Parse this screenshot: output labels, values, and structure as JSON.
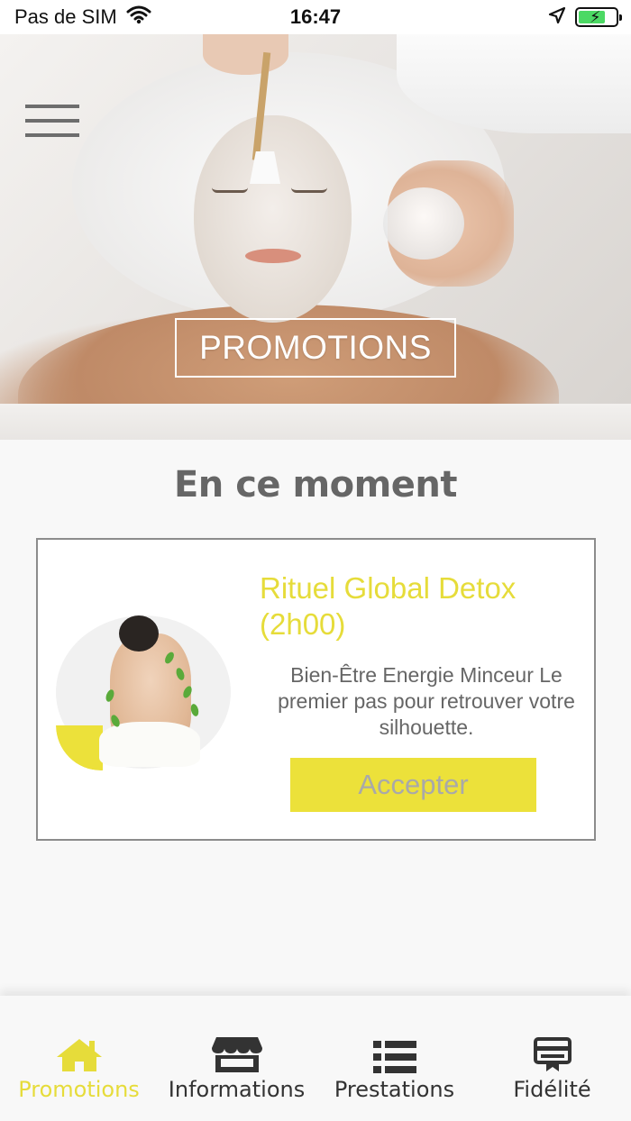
{
  "status_bar": {
    "carrier": "Pas de SIM",
    "time": "16:47",
    "battery_level": 0.72
  },
  "hero": {
    "title": "PROMOTIONS"
  },
  "section": {
    "title": "En ce moment"
  },
  "promotion": {
    "title": "Rituel Global Detox (2h00)",
    "description": "Bien-Être Energie Minceur Le premier pas pour retrouver votre silhouette.",
    "button_label": "Accepter"
  },
  "tab_bar": {
    "tabs": [
      {
        "label": "Promotions",
        "icon": "home-icon",
        "active": true
      },
      {
        "label": "Informations",
        "icon": "store-icon",
        "active": false
      },
      {
        "label": "Prestations",
        "icon": "list-icon",
        "active": false
      },
      {
        "label": "Fidélité",
        "icon": "loyalty-card-icon",
        "active": false
      }
    ]
  },
  "colors": {
    "accent": "#e6dc3a",
    "button_bg": "#ece13a",
    "text_gray": "#666666",
    "tab_icon": "#333333"
  }
}
